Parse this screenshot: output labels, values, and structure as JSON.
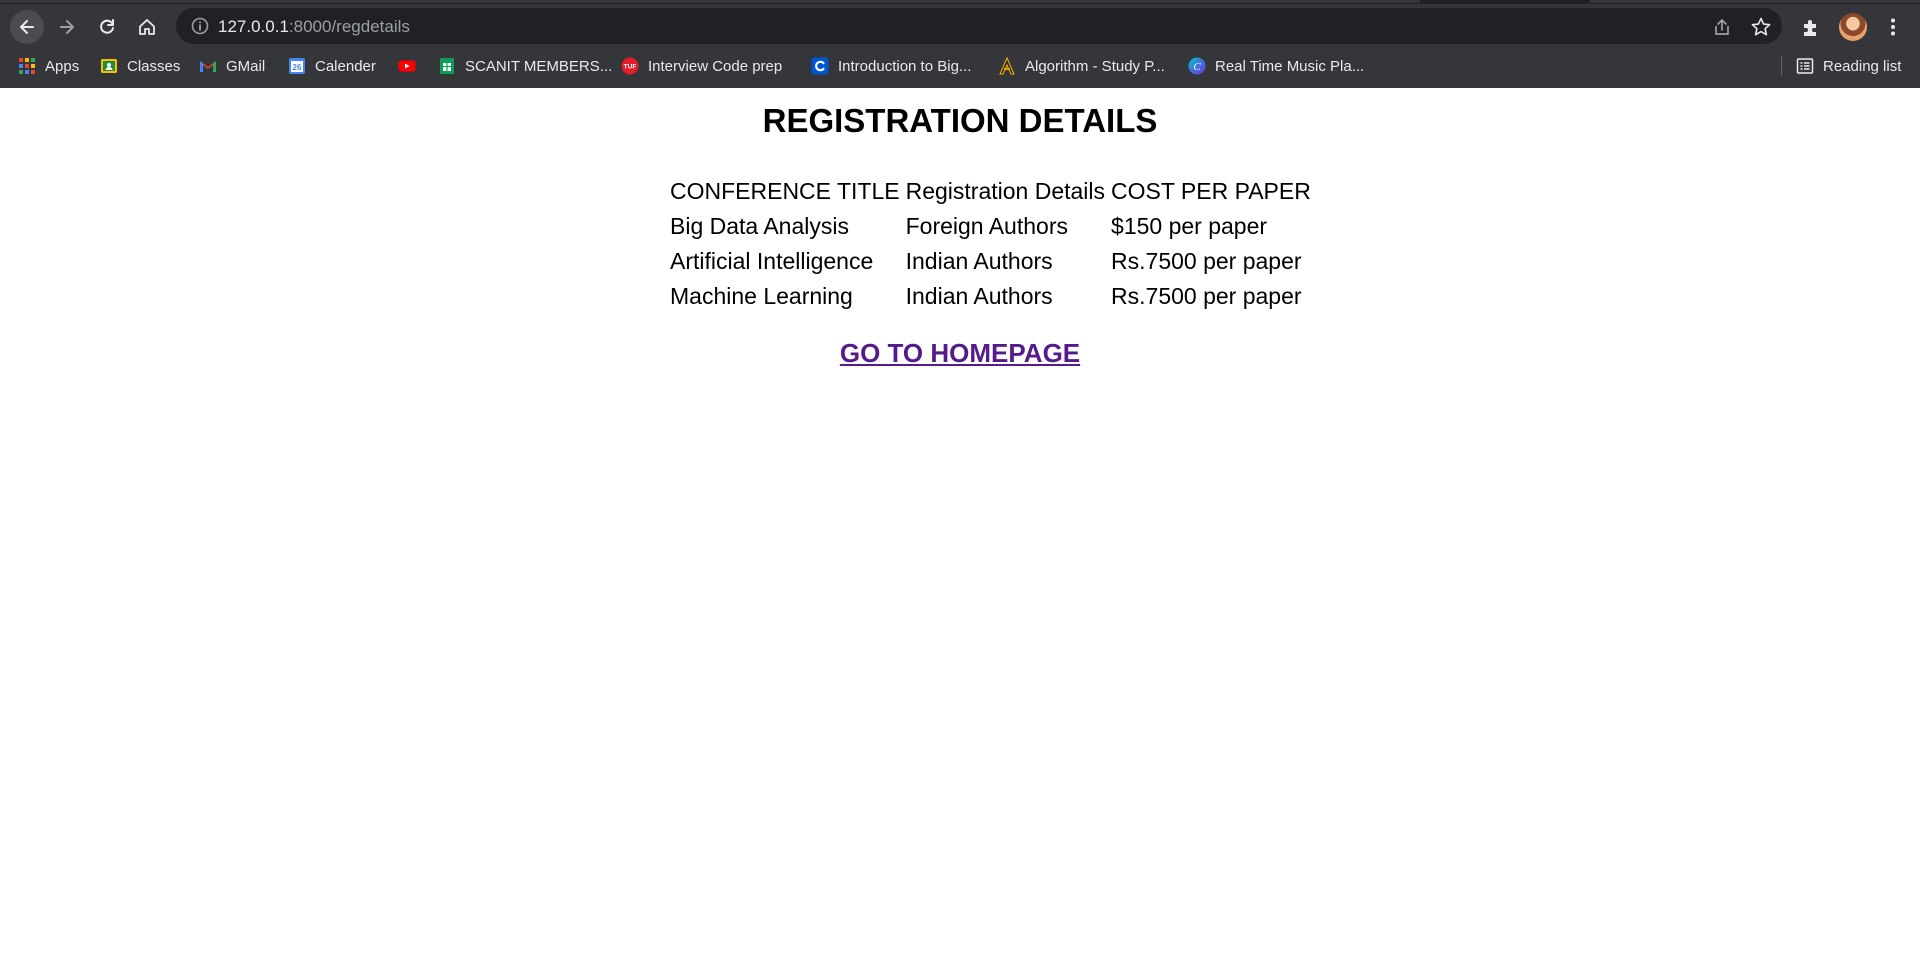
{
  "browser": {
    "url_host": "127.0.0.1",
    "url_rest": ":8000/regdetails",
    "bookmarks": [
      {
        "label": "Apps",
        "icon": "apps-grid-icon"
      },
      {
        "label": "Classes",
        "icon": "classroom-icon"
      },
      {
        "label": "GMail",
        "icon": "gmail-icon"
      },
      {
        "label": "Calender",
        "icon": "calendar-icon"
      },
      {
        "label": "",
        "icon": "youtube-icon"
      },
      {
        "label": "SCANIT MEMBERS...",
        "icon": "sheets-icon"
      },
      {
        "label": "Interview Code prep",
        "icon": "tuf-icon"
      },
      {
        "label": "Introduction to Big...",
        "icon": "coursera-icon"
      },
      {
        "label": "Algorithm - Study P...",
        "icon": "algorithm-icon"
      },
      {
        "label": "Real Time Music Pla...",
        "icon": "canva-icon"
      }
    ],
    "calendar_day": "26",
    "tuf_text": "TUF",
    "reading_list": "Reading list"
  },
  "page": {
    "title": "REGISTRATION DETAILS",
    "table": {
      "headers": [
        "CONFERENCE TITLE",
        "Registration Details",
        "COST PER PAPER"
      ],
      "rows": [
        [
          "Big Data Analysis",
          "Foreign Authors",
          "$150 per paper"
        ],
        [
          "Artificial Intelligence",
          "Indian Authors",
          "Rs.7500 per paper"
        ],
        [
          "Machine Learning",
          "Indian Authors",
          "Rs.7500 per paper"
        ]
      ]
    },
    "home_link": "GO TO HOMEPAGE"
  }
}
